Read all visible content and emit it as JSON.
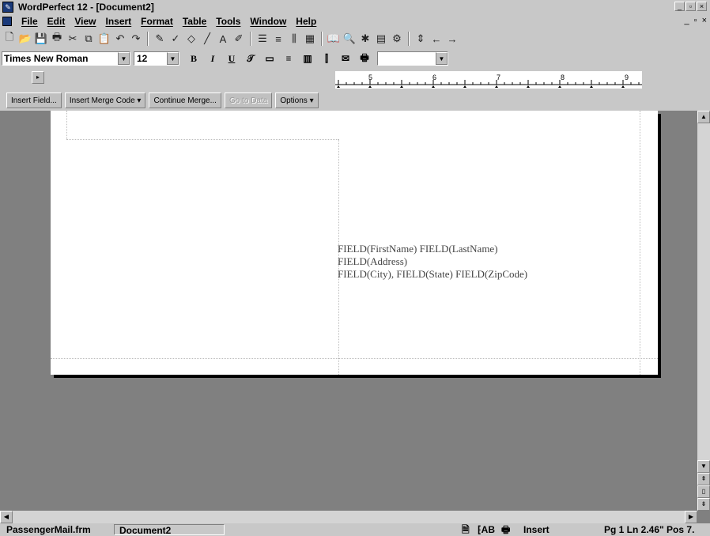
{
  "window": {
    "title": "WordPerfect 12 - [Document2]"
  },
  "menu": [
    "File",
    "Edit",
    "View",
    "Insert",
    "Format",
    "Table",
    "Tools",
    "Window",
    "Help"
  ],
  "property_bar": {
    "font": "Times New Roman",
    "size": "12"
  },
  "ruler": {
    "labels": [
      "5",
      "6",
      "7",
      "8",
      "9"
    ]
  },
  "merge_bar": {
    "insert_field": "Insert Field...",
    "insert_merge_code": "Insert Merge Code",
    "continue_merge": "Continue Merge...",
    "go_to_data": "Go to Data",
    "options": "Options"
  },
  "document": {
    "lines": [
      "FIELD(FirstName) FIELD(LastName)",
      "FIELD(Address)",
      "FIELD(City), FIELD(State) FIELD(ZipCode)"
    ]
  },
  "status": {
    "file": "PassengerMail.frm",
    "document": "Document2",
    "mode": "Insert",
    "position": "Pg 1 Ln 2.46\" Pos 7."
  }
}
